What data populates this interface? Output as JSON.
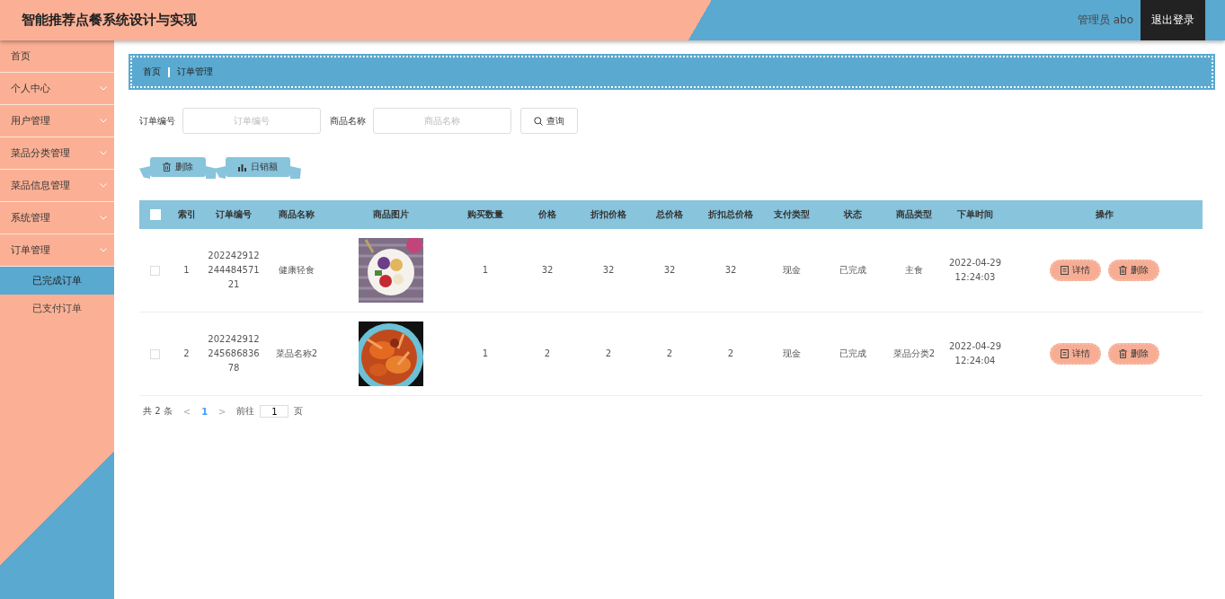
{
  "header": {
    "title": "智能推荐点餐系统设计与实现",
    "user": "管理员 abo",
    "logout": "退出登录"
  },
  "sidebar": {
    "items": [
      {
        "label": "首页",
        "kind": "link"
      },
      {
        "label": "个人中心",
        "kind": "group"
      },
      {
        "label": "用户管理",
        "kind": "group"
      },
      {
        "label": "菜品分类管理",
        "kind": "group"
      },
      {
        "label": "菜品信息管理",
        "kind": "group"
      },
      {
        "label": "系统管理",
        "kind": "group"
      },
      {
        "label": "订单管理",
        "kind": "group",
        "children": [
          {
            "label": "已完成订单",
            "selected": true
          },
          {
            "label": "已支付订单",
            "selected": false
          }
        ]
      }
    ]
  },
  "breadcrumb": [
    "首页",
    "订单管理"
  ],
  "search": {
    "fields": [
      {
        "label": "订单编号",
        "placeholder": "订单编号"
      },
      {
        "label": "商品名称",
        "placeholder": "商品名称"
      }
    ],
    "button": "查询"
  },
  "actions": [
    {
      "label": "删除",
      "kind": "delete"
    },
    {
      "label": "日销额",
      "kind": "chart"
    }
  ],
  "table": {
    "select_all_checked": false,
    "columns": [
      "索引",
      "订单编号",
      "商品名称",
      "商品图片",
      "购买数量",
      "价格",
      "折扣价格",
      "总价格",
      "折扣总价格",
      "支付类型",
      "状态",
      "商品类型",
      "下单时间",
      "操作"
    ],
    "rows": [
      {
        "checked": false,
        "index": "1",
        "order_no": "20224291224448457121",
        "name": "健康轻食",
        "qty": "1",
        "price": "32",
        "discount_price": "32",
        "total": "32",
        "discount_total": "32",
        "pay_type": "现金",
        "status": "已完成",
        "category": "主食",
        "time": "2022-04-29 12:24:03",
        "buttons": [
          "详情",
          "删除"
        ]
      },
      {
        "checked": false,
        "index": "2",
        "order_no": "20224291224568683678",
        "name": "菜品名称2",
        "qty": "1",
        "price": "2",
        "discount_price": "2",
        "total": "2",
        "discount_total": "2",
        "pay_type": "现金",
        "status": "已完成",
        "category": "菜品分类2",
        "time": "2022-04-29 12:24:04",
        "buttons": [
          "详情",
          "删除"
        ]
      }
    ]
  },
  "pagination": {
    "total": "共 2 条",
    "prev": "<",
    "pages": [
      {
        "label": "1",
        "selected": true
      }
    ],
    "next": ">",
    "goto": "前往",
    "page_value": "1",
    "suffix": "页"
  }
}
